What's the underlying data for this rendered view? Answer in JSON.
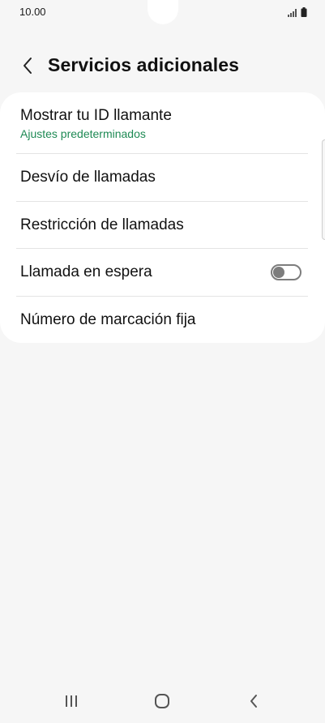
{
  "status_bar": {
    "time": "10.00",
    "icons": [
      "signal-icon",
      "battery-icon"
    ]
  },
  "header": {
    "back_icon": "chevron-left-icon",
    "title": "Servicios adicionales"
  },
  "settings": {
    "items": [
      {
        "label": "Mostrar tu ID llamante",
        "sublabel": "Ajustes predeterminados"
      },
      {
        "label": "Desvío de llamadas"
      },
      {
        "label": "Restricción de llamadas"
      },
      {
        "label": "Llamada en espera",
        "toggle": "off"
      },
      {
        "label": "Número de marcación fija"
      }
    ]
  },
  "colors": {
    "background": "#f6f6f6",
    "card": "#ffffff",
    "accent_green": "#1e8a54",
    "toggle_off": "#7d7d7d"
  },
  "nav_bar": {
    "icons": [
      "recent-apps-icon",
      "home-icon",
      "back-icon"
    ]
  }
}
